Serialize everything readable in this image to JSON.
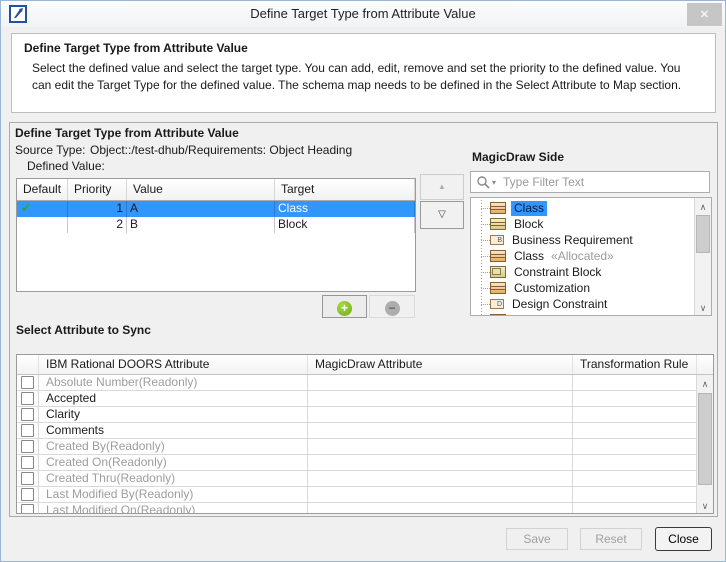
{
  "window": {
    "title": "Define Target Type from Attribute Value"
  },
  "header": {
    "title": "Define Target Type from Attribute Value",
    "description": "Select the defined value and select the target type. You can add, edit, remove and set the priority to the defined value. You can edit the Target Type for the defined value. The schema map needs to be defined in the Select Attribute to Map section."
  },
  "define_section": {
    "title": "Define Target Type from Attribute Value",
    "source_type_label": "Source Type:",
    "source_type_value": "Object::/test-dhub/Requirements: Object Heading",
    "defined_value_label": "Defined Value:",
    "columns": {
      "default": "Default",
      "priority": "Priority",
      "value": "Value",
      "target": "Target"
    },
    "rows": [
      {
        "default": true,
        "priority": "1",
        "value": "A",
        "target": "Class",
        "selected": true
      },
      {
        "default": false,
        "priority": "2",
        "value": "B",
        "target": "Block",
        "selected": false
      }
    ]
  },
  "magicdraw_side": {
    "title": "MagicDraw Side",
    "filter_placeholder": "Type Filter Text",
    "tree_items": [
      {
        "label": "Class",
        "selected": true
      },
      {
        "label": "Block"
      },
      {
        "label": "Business Requirement"
      },
      {
        "label": "Class",
        "suffix": "«Allocated»"
      },
      {
        "label": "Constraint Block"
      },
      {
        "label": "Customization"
      },
      {
        "label": "Design Constraint"
      }
    ]
  },
  "sync_section": {
    "title": "Select Attribute to Sync",
    "columns": {
      "doors": "IBM Rational DOORS Attribute",
      "magicdraw": "MagicDraw Attribute",
      "rule": "Transformation Rule"
    },
    "rows": [
      {
        "label": "Absolute Number(Readonly)",
        "readonly": true
      },
      {
        "label": "Accepted",
        "readonly": false
      },
      {
        "label": "Clarity",
        "readonly": false
      },
      {
        "label": "Comments",
        "readonly": false
      },
      {
        "label": "Created By(Readonly)",
        "readonly": true
      },
      {
        "label": "Created On(Readonly)",
        "readonly": true
      },
      {
        "label": "Created Thru(Readonly)",
        "readonly": true
      },
      {
        "label": "Last Modified By(Readonly)",
        "readonly": true
      },
      {
        "label": "Last Modified On(Readonly)",
        "readonly": true
      }
    ]
  },
  "footer": {
    "save": "Save",
    "reset": "Reset",
    "close": "Close"
  },
  "colors": {
    "selection_blue": "#3296FF",
    "check_green": "#2FA52F",
    "add_green": "#6FAE12",
    "window_border": "#9AB6D4"
  }
}
